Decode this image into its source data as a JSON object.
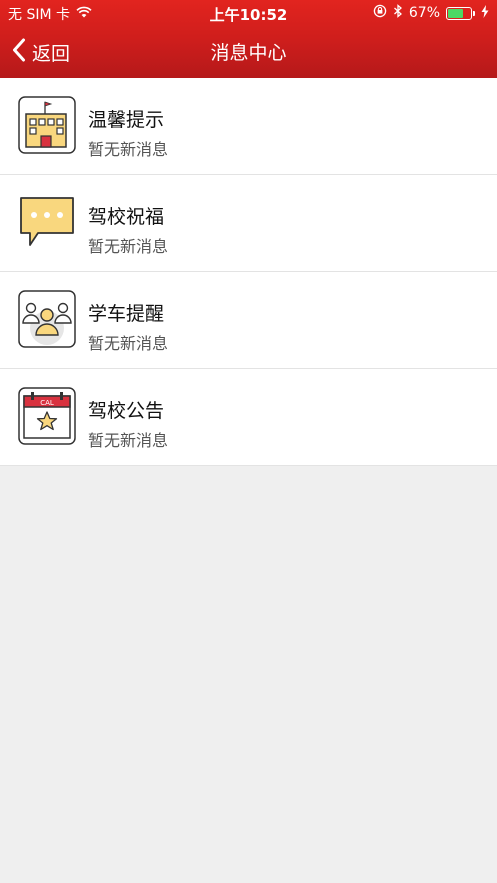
{
  "status_bar": {
    "carrier": "无 SIM 卡",
    "time": "上午10:52",
    "battery_percent": "67%",
    "battery_level": 0.67,
    "icons": [
      "wifi-icon",
      "orientation-lock-icon",
      "bluetooth-icon",
      "battery-icon",
      "charging-icon"
    ]
  },
  "nav": {
    "back_label": "返回",
    "title": "消息中心"
  },
  "messages": [
    {
      "title": "温馨提示",
      "subtitle": "暂无新消息",
      "icon": "school-building-icon"
    },
    {
      "title": "驾校祝福",
      "subtitle": "暂无新消息",
      "icon": "chat-bubble-icon"
    },
    {
      "title": "学车提醒",
      "subtitle": "暂无新消息",
      "icon": "people-group-icon"
    },
    {
      "title": "驾校公告",
      "subtitle": "暂无新消息",
      "icon": "calendar-star-icon"
    }
  ],
  "calendar_icon_text": "CAL",
  "colors": {
    "header_red": "#cf1e1c",
    "icon_yellow": "#f9d77e",
    "icon_red": "#d8323f",
    "battery_green": "#4cd964",
    "background": "#efefef"
  }
}
